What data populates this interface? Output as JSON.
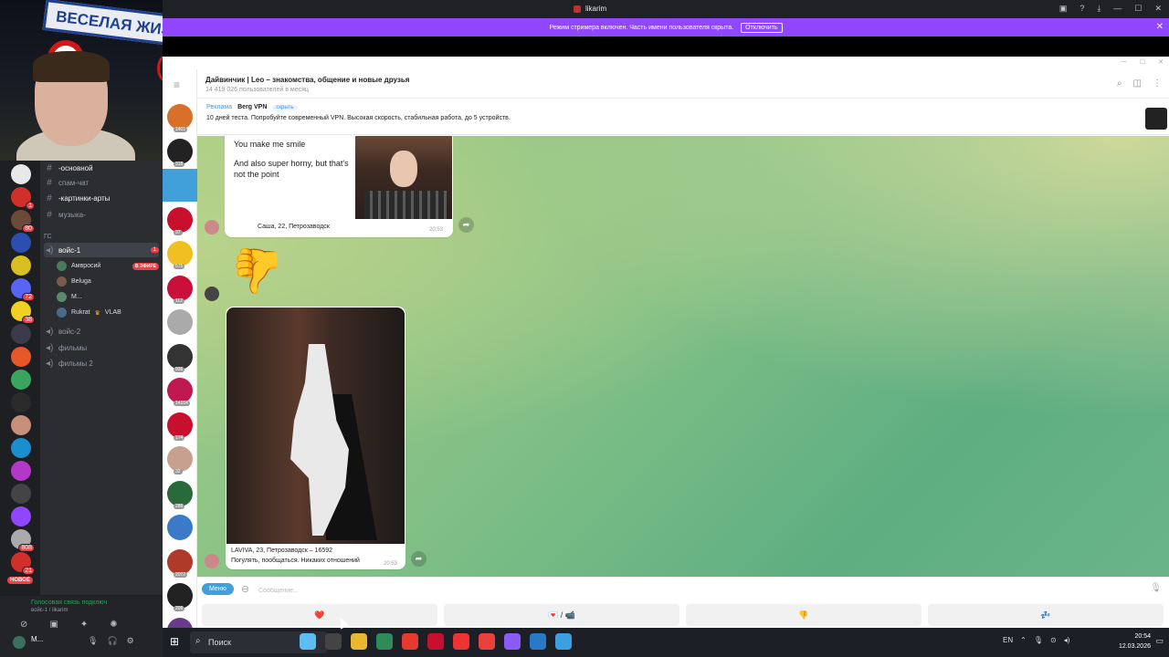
{
  "webcam": {
    "sign_text": "ВЕСЕЛАЯ ЖИЗ"
  },
  "discord": {
    "servers": [
      {
        "color": "#e8e8e8",
        "badge": ""
      },
      {
        "color": "#d0302a",
        "badge": "1"
      },
      {
        "color": "#6b4a3a",
        "badge": "80"
      },
      {
        "color": "#2b4fb0",
        "badge": ""
      },
      {
        "color": "#d8c020",
        "badge": ""
      },
      {
        "color": "#5865f2",
        "badge": "72"
      },
      {
        "color": "#f0d020",
        "badge": "38"
      },
      {
        "color": "#3a3a48",
        "badge": ""
      },
      {
        "color": "#e8572a",
        "badge": ""
      },
      {
        "color": "#3aa55d",
        "badge": ""
      },
      {
        "color": "#2a2a2a",
        "badge": ""
      },
      {
        "color": "#c8907a",
        "badge": ""
      },
      {
        "color": "#1a8fd0",
        "badge": ""
      },
      {
        "color": "#b338c8",
        "badge": ""
      },
      {
        "color": "#444",
        "badge": ""
      },
      {
        "color": "#9146ff",
        "badge": ""
      },
      {
        "color": "#aaa",
        "badge": "808"
      },
      {
        "color": "#d0302a",
        "badge": "21"
      }
    ],
    "new_label": "НОВОЕ",
    "channels": {
      "ch1": "-основной",
      "ch2": "спам-чат",
      "ch3": "-картинки-арты",
      "ch4": "музыка-",
      "category": "ГС",
      "voice1": "войс-1",
      "voice1_count": "1",
      "users": [
        {
          "name": "Амвросий",
          "live": "В ЭФИРЕ"
        },
        {
          "name": "Beluga",
          "live": ""
        },
        {
          "name": "М...",
          "live": ""
        },
        {
          "name": "Rukrat",
          "tag": "VLAB",
          "live": ""
        }
      ],
      "voice2": "войс-2",
      "films1": "фильмы",
      "films2": "фильмы 2"
    },
    "voice_panel": {
      "status": "Голосовая связь подключ",
      "sub": "войс-1 / likarim"
    },
    "user_name": "М..."
  },
  "browser": {
    "title": "likarim",
    "streamer_text": "Режим стримера включен. Часть имени пользователя скрыта.",
    "streamer_button": "Отключить"
  },
  "telegram": {
    "chat_title": "Дайвинчик | Leo – знакомства, общение и новые друзья",
    "chat_subtitle": "14 419 026 пользователей в месяц",
    "ad": {
      "label": "Реклама",
      "name": "Berg VPN",
      "hide": "скрыть",
      "text": "10 дней теста. Попробуйте современный VPN. Высокая скорость, стабильная работа, до 5 устройств."
    },
    "sidebar_counts": [
      "1401",
      "318",
      "",
      "37",
      "575",
      "112",
      "",
      "936",
      "14104",
      "174",
      "32",
      "286",
      "",
      "2072",
      "206",
      ""
    ],
    "messages": [
      {
        "line1": "You make me smile",
        "line2": "And also super horny, but that's not the point",
        "caption": "Саша, 22, Петрозаводск",
        "time": "20:53"
      },
      {
        "caption_line1": "LAVIVA, 23, Петрозаводск – 16592",
        "caption_line2": "Погулять, пообщаться. Никаких отношений",
        "time": "20:53"
      }
    ],
    "menu_button": "Меню",
    "input_placeholder": "Сообщение...",
    "keyboard": [
      "❤️",
      "💌 / 📹",
      "👎",
      "💤"
    ]
  },
  "taskbar": {
    "search_label": "Поиск",
    "lang": "EN",
    "time": "20:54",
    "date": "12.03.2026",
    "apps": [
      "#5dbdf0",
      "#444",
      "#e8b830",
      "#2e8b57",
      "#e63a2e",
      "#c8102e",
      "#e33",
      "#e8403a",
      "#8a5cf6",
      "#2a79c8",
      "#3ca0e0"
    ]
  }
}
